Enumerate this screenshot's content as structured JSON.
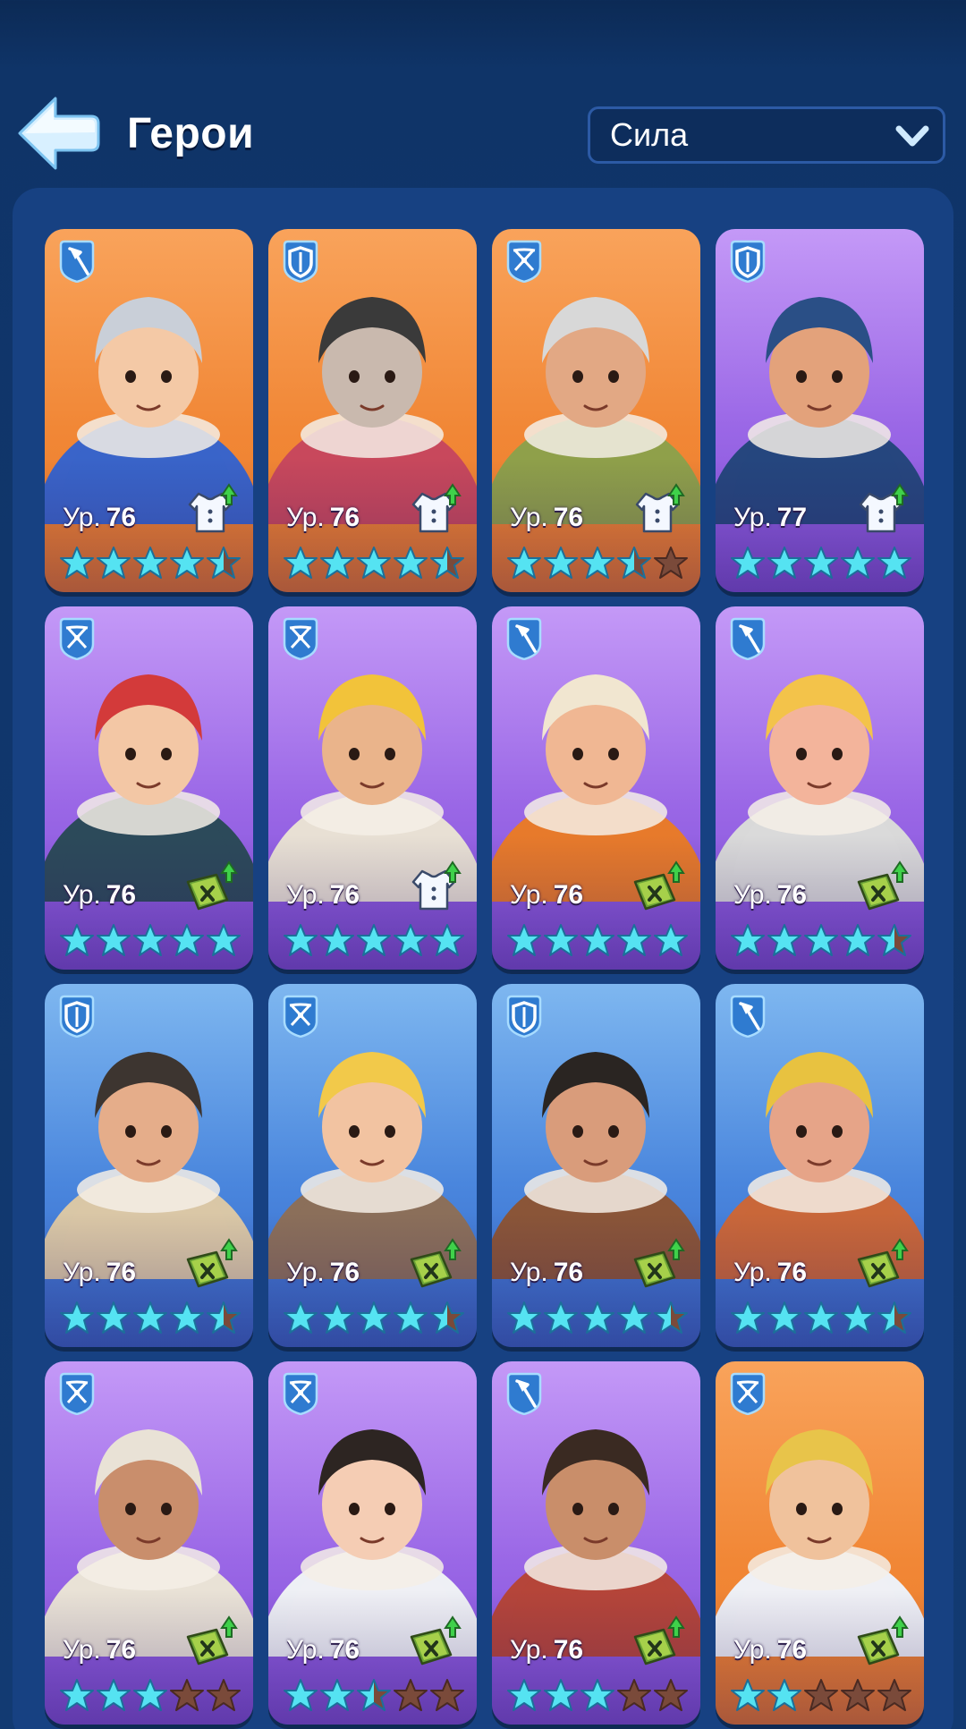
{
  "header": {
    "title": "Герои",
    "sort": {
      "selected": "Сила"
    }
  },
  "colors": {
    "orange": "#f18736",
    "purple": "#9a67e6",
    "blue": "#4a86dd",
    "star_filled": "#55e3f2",
    "star_empty": "#7a4a3a"
  },
  "heroes": [
    {
      "role": "spear-icon",
      "bg": "orange",
      "level_prefix": "Ур.",
      "level": "76",
      "upgrade": "outfit-upgrade-icon",
      "stars": 4.5,
      "hair": "#c9cfd8",
      "skin": "#f4c9a6",
      "coat": "#3a64c9"
    },
    {
      "role": "shield-icon",
      "bg": "orange",
      "level_prefix": "Ур.",
      "level": "76",
      "upgrade": "outfit-upgrade-icon",
      "stars": 4.5,
      "hair": "#3a3a3a",
      "skin": "#c9b9ae",
      "coat": "#c8485c"
    },
    {
      "role": "crossbow-icon",
      "bg": "orange",
      "level_prefix": "Ур.",
      "level": "76",
      "upgrade": "outfit-upgrade-icon",
      "stars": 3.5,
      "hair": "#d8d8d8",
      "skin": "#e2a884",
      "coat": "#8fa04a"
    },
    {
      "role": "shield-icon",
      "bg": "purple",
      "level_prefix": "Ур.",
      "level": "77",
      "upgrade": "outfit-upgrade-icon",
      "stars": 5,
      "hair": "#2a4f86",
      "skin": "#e3a27b",
      "coat": "#26467e"
    },
    {
      "role": "crossbow-icon",
      "bg": "purple",
      "level_prefix": "Ур.",
      "level": "76",
      "upgrade": "manual-upgrade-icon",
      "stars": 5,
      "hair": "#d33a3a",
      "skin": "#f3c7a5",
      "coat": "#2c4a5a"
    },
    {
      "role": "crossbow-icon",
      "bg": "purple",
      "level_prefix": "Ур.",
      "level": "76",
      "upgrade": "outfit-upgrade-icon",
      "stars": 5,
      "hair": "#f2c33a",
      "skin": "#eab48b",
      "coat": "#e8e0d4"
    },
    {
      "role": "spear-icon",
      "bg": "purple",
      "level_prefix": "Ур.",
      "level": "76",
      "upgrade": "manual-upgrade-icon",
      "stars": 5,
      "hair": "#f1e6d0",
      "skin": "#f0b793",
      "coat": "#e77a2b"
    },
    {
      "role": "spear-icon",
      "bg": "purple",
      "level_prefix": "Ур.",
      "level": "76",
      "upgrade": "manual-upgrade-icon",
      "stars": 4.5,
      "hair": "#f3c34a",
      "skin": "#f3b49b",
      "coat": "#d9d9d9"
    },
    {
      "role": "shield-icon",
      "bg": "blue",
      "level_prefix": "Ур.",
      "level": "76",
      "upgrade": "manual-upgrade-icon",
      "stars": 4.5,
      "hair": "#3d3530",
      "skin": "#e5ad8a",
      "coat": "#d9c7a6"
    },
    {
      "role": "crossbow-icon",
      "bg": "blue",
      "level_prefix": "Ур.",
      "level": "76",
      "upgrade": "manual-upgrade-icon",
      "stars": 4.5,
      "hair": "#f2c94a",
      "skin": "#f2c3a1",
      "coat": "#8b6f5a"
    },
    {
      "role": "shield-icon",
      "bg": "blue",
      "level_prefix": "Ур.",
      "level": "76",
      "upgrade": "manual-upgrade-icon",
      "stars": 4.5,
      "hair": "#2a2522",
      "skin": "#d99c7b",
      "coat": "#8a5538"
    },
    {
      "role": "spear-icon",
      "bg": "blue",
      "level_prefix": "Ур.",
      "level": "76",
      "upgrade": "manual-upgrade-icon",
      "stars": 4.5,
      "hair": "#e8c240",
      "skin": "#e6a488",
      "coat": "#c9673a"
    },
    {
      "role": "crossbow-icon",
      "bg": "purple",
      "level_prefix": "Ур.",
      "level": "76",
      "upgrade": "manual-upgrade-icon",
      "stars": 3,
      "hair": "#e9e2d6",
      "skin": "#c98e6c",
      "coat": "#e9e2d6"
    },
    {
      "role": "crossbow-icon",
      "bg": "purple",
      "level_prefix": "Ур.",
      "level": "76",
      "upgrade": "manual-upgrade-icon",
      "stars": 2.5,
      "hair": "#2d2522",
      "skin": "#f5cdb4",
      "coat": "#eef0f5"
    },
    {
      "role": "spear-icon",
      "bg": "purple",
      "level_prefix": "Ур.",
      "level": "76",
      "upgrade": "manual-upgrade-icon",
      "stars": 3,
      "hair": "#3a2a22",
      "skin": "#c98e6a",
      "coat": "#b5453a"
    },
    {
      "role": "crossbow-icon",
      "bg": "orange",
      "level_prefix": "Ур.",
      "level": "76",
      "upgrade": "manual-upgrade-icon",
      "stars": 2,
      "hair": "#e8c44a",
      "skin": "#f0c29c",
      "coat": "#eef0f5"
    }
  ]
}
